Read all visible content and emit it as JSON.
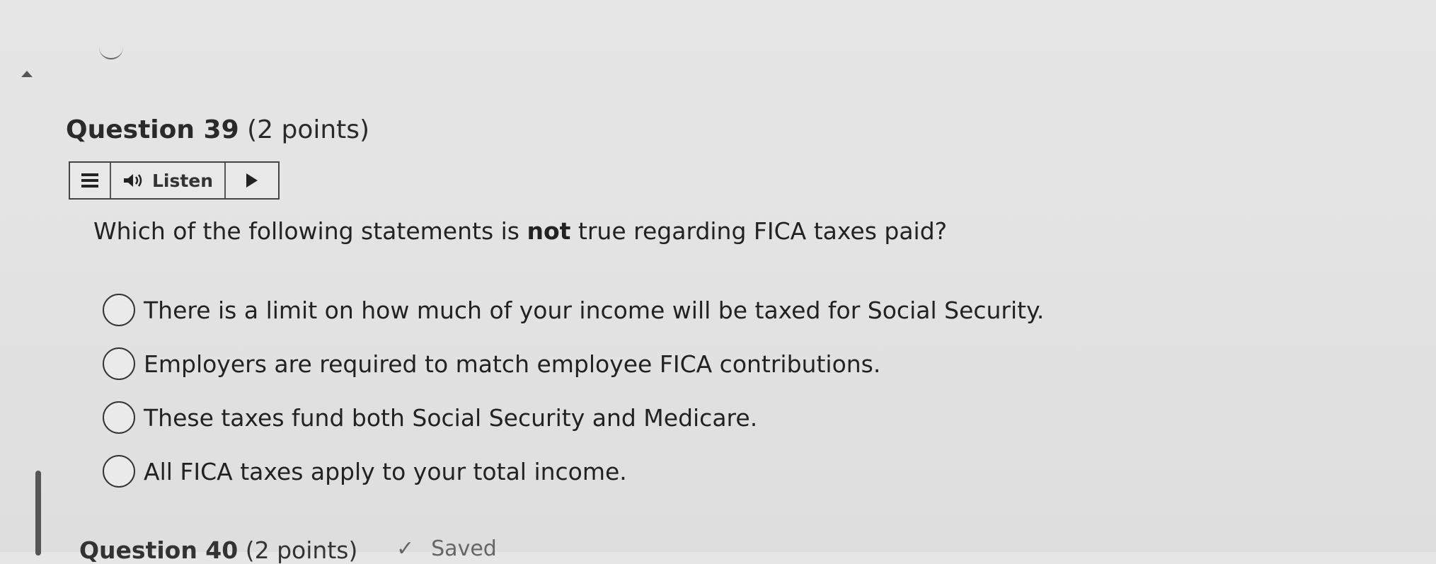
{
  "question": {
    "title_main": "Question 39",
    "title_points": "(2 points)",
    "prompt_before": "Which of the following statements is ",
    "prompt_bold": "not",
    "prompt_after": " true regarding FICA taxes paid?",
    "options": [
      "There is a limit on how much of your income will be taxed for Social Security.",
      "Employers are required to match employee FICA contributions.",
      "These taxes fund both Social Security and Medicare.",
      "All FICA taxes apply to your total income."
    ]
  },
  "toolbar": {
    "listen_label": "Listen",
    "icons": [
      "menu-icon",
      "speaker-icon",
      "play-icon"
    ]
  },
  "next_question": {
    "title_main": "Question 40",
    "title_points": "(2 points)",
    "saved_label": "Saved"
  },
  "colors": {
    "background": "#e4e4e4",
    "text": "#222222"
  }
}
